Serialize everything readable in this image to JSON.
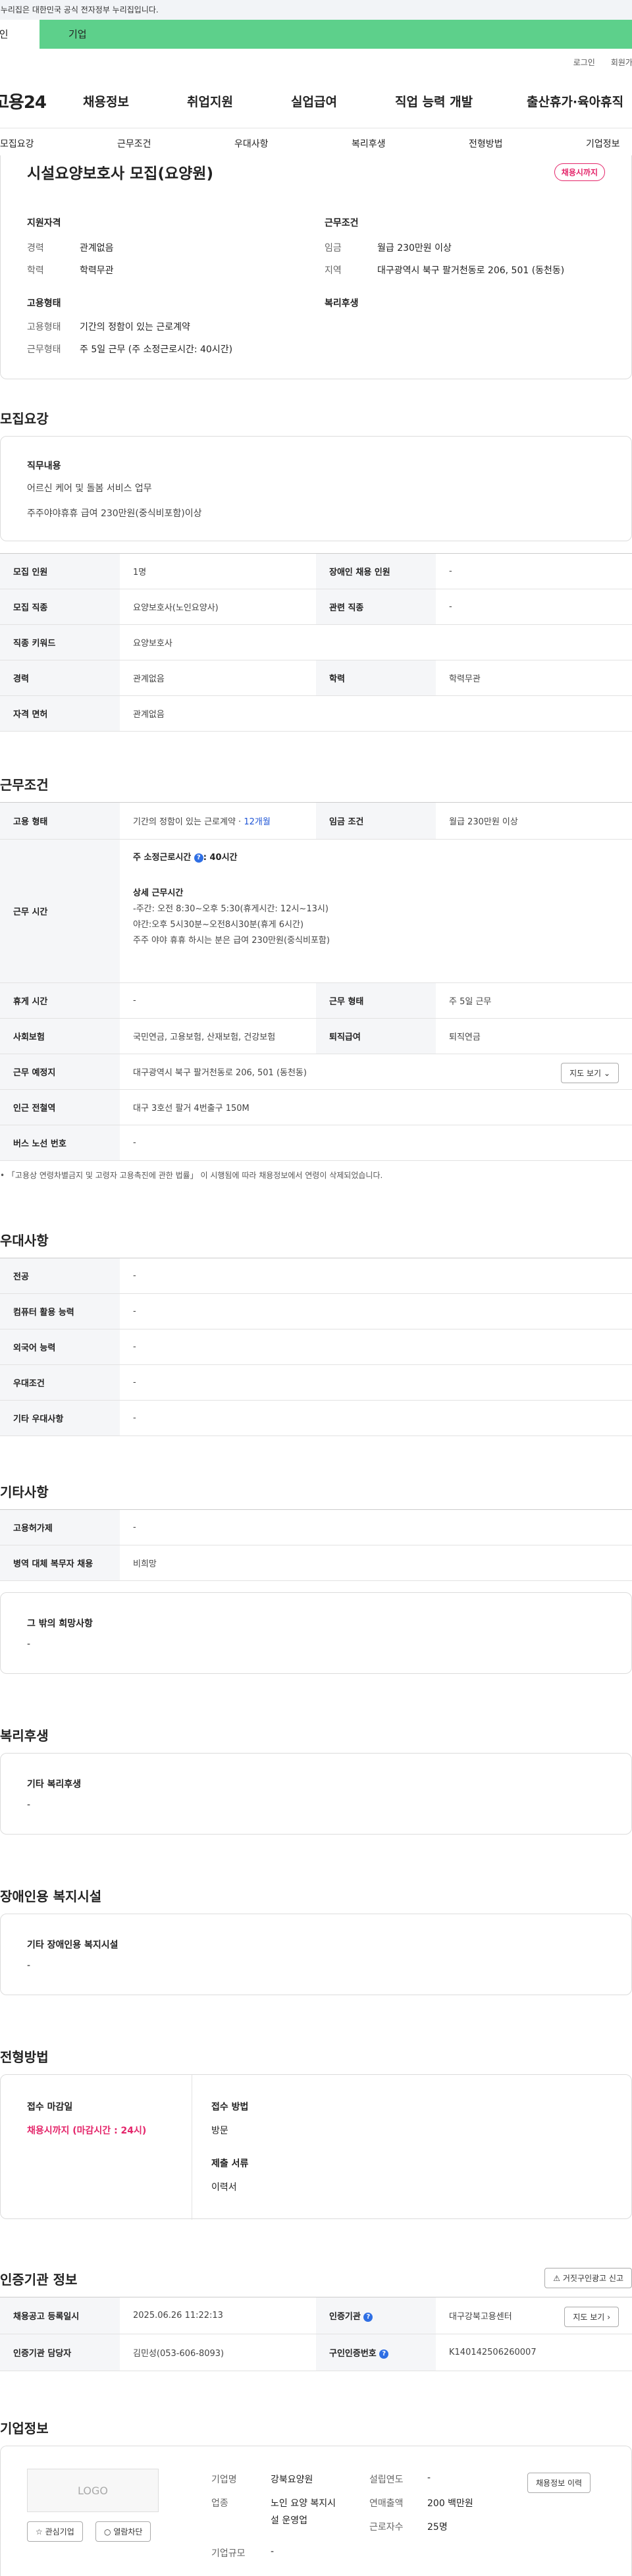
{
  "gov_banner": "이 누리집은 대한민국 공식 전자정부 누리집입니다.",
  "user_tabs": {
    "personal": "개인",
    "company": "기업"
  },
  "util": {
    "login": "로그인",
    "signup": "회원가입"
  },
  "logo": "고용24",
  "gnb": [
    "채용정보",
    "취업지원",
    "실업급여",
    "직업 능력 개발",
    "출산휴가·육아휴직"
  ],
  "section_tabs": [
    "모집요강",
    "근무조건",
    "우대사항",
    "복리후생",
    "전형방법",
    "기업정보"
  ],
  "summary": {
    "title": "시설요양보호사 모집(요양원)",
    "badge": "채용시까지",
    "qual_heading": "지원자격",
    "career_label": "경력",
    "career_value": "관계없음",
    "edu_label": "학력",
    "edu_value": "학력무관",
    "cond_heading": "근무조건",
    "wage_label": "임금",
    "wage_value": "월급 230만원 이상",
    "region_label": "지역",
    "region_value": "대구광역시 북구 팔거천동로 206, 501 (동천동)",
    "emp_heading": "고용형태",
    "emp_label": "고용형태",
    "emp_value": "기간의 정함이 있는 근로계약",
    "work_label": "근무형태",
    "work_value": "주 5일 근무 (주 소정근로시간: 40시간)",
    "welfare_heading": "복리후생"
  },
  "recruit": {
    "heading": "모집요강",
    "duty_title": "직무내용",
    "duty_line1": "어르신 케어 및 돌봄 서비스 업무",
    "duty_line2": "주주야야휴휴  급여 230만원(중식비포함)이상",
    "rows": {
      "count_label": "모집 인원",
      "count_value": "1명",
      "disabled_label": "장애인 채용 인원",
      "disabled_value": "-",
      "job_label": "모집 직종",
      "job_value": "요양보호사(노인요양사)",
      "related_label": "관련 직종",
      "related_value": "-",
      "keyword_label": "직종 키워드",
      "keyword_value": "요양보호사",
      "career_label": "경력",
      "career_value": "관계없음",
      "edu_label": "학력",
      "edu_value": "학력무관",
      "license_label": "자격 면허",
      "license_value": "관계없음"
    }
  },
  "conditions": {
    "heading": "근무조건",
    "emp_label": "고용 형태",
    "emp_value": "기간의 정함이 있는 근로계약 · ",
    "emp_months": "12개월",
    "wage_label": "임금 조건",
    "wage_value": "월급 230만원 이상",
    "hours_label": "근무 시간",
    "hours_main": "주 소정근로시간",
    "hours_main_value": ": 40시간",
    "hours_detail_title": "상세 근무시간",
    "hours_line1": "-주간: 오전 8:30~오후 5:30(휴게시간: 12시~13시)",
    "hours_line2": "야간:오후 5시30분~오전8시30분(휴게 6시간)",
    "hours_line3": "주주 야야 휴휴 하시는 분은  급여 230만원(중식비포함)",
    "break_label": "휴게 시간",
    "break_value": "-",
    "workform_label": "근무 형태",
    "workform_value": "주 5일 근무",
    "insurance_label": "사회보험",
    "insurance_value": "국민연금, 고용보험, 산재보험, 건강보험",
    "severance_label": "퇴직급여",
    "severance_value": "퇴직연금",
    "place_label": "근무 예정지",
    "place_value": "대구광역시 북구 팔거천동로 206, 501 (동천동)",
    "map_btn": "지도 보기",
    "subway_label": "인근 전철역",
    "subway_value": "대구 3호선 팔거 4번출구 150M",
    "bus_label": "버스 노선 번호",
    "bus_value": "-",
    "note": "「고용상 연령차별금지 및 고령자 고용촉진에 관한 법률」 이 시행됨에 따라 채용정보에서 연령이 삭제되었습니다."
  },
  "preference": {
    "heading": "우대사항",
    "major_label": "전공",
    "major_value": "-",
    "computer_label": "컴퓨터 활용 능력",
    "computer_value": "-",
    "language_label": "외국어 능력",
    "language_value": "-",
    "pref_label": "우대조건",
    "pref_value": "-",
    "other_label": "기타 우대사항",
    "other_value": "-"
  },
  "etc": {
    "heading": "기타사항",
    "permit_label": "고용허가제",
    "permit_value": "-",
    "military_label": "병역 대체 복무자 채용",
    "military_value": "비희망",
    "other_title": "그 밖의 희망사항",
    "other_value": "-"
  },
  "welfare": {
    "heading": "복리후생",
    "title": "기타 복리후생",
    "value": "-"
  },
  "disabled_facility": {
    "heading": "장애인용 복지시설",
    "title": "기타 장애인용 복지시설",
    "value": "-"
  },
  "selection": {
    "heading": "전형방법",
    "deadline_title": "접수 마감일",
    "deadline_value": "채용시까지 (마감시간 : 24시)",
    "method_title": "접수 방법",
    "method_value": "방문",
    "docs_title": "제출 서류",
    "docs_value": "이력서"
  },
  "certification": {
    "heading": "인증기관 정보",
    "report_btn": "거짓구인광고 신고",
    "registered_label": "채용공고 등록일시",
    "registered_value": "2025.06.26 11:22:13",
    "agency_label": "인증기관",
    "agency_value": "대구강북고용센터",
    "map_btn": "지도 보기",
    "manager_label": "인증기관 담당자",
    "manager_value": "김민성(053-606-8093)",
    "number_label": "구인인증번호",
    "number_value": "K140142506260007"
  },
  "company": {
    "heading": "기업정보",
    "logo_text": "LOGO",
    "fav_btn": "관심기업",
    "block_btn": "열람차단",
    "name_label": "기업명",
    "name_value": "강북요양원",
    "year_label": "설립연도",
    "year_value": "-",
    "history_btn": "채용정보 이력",
    "industry_label": "업종",
    "industry_value_1": "노인 요양 복지시",
    "industry_value_2": "설 운영업",
    "sales_label": "연매출액",
    "sales_value": "200 백만원",
    "employees_label": "근로자수",
    "employees_value": "25명",
    "size_label": "기업규모",
    "size_value": "-"
  }
}
